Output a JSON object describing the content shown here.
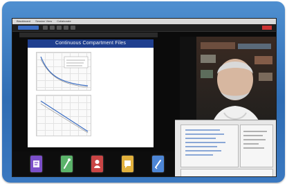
{
  "menubar": {
    "items": [
      "Blackboard",
      "Session View",
      "Collaborate"
    ]
  },
  "slide": {
    "title": "Continuous Compartment Files"
  },
  "colors": {
    "frame": "#3a78c0",
    "slide_title_bg": "#1f3f8f",
    "dock_purple": "#7b4fc9",
    "dock_green": "#5bb36a",
    "dock_red": "#c94545",
    "dock_yellow": "#e2b13d",
    "dock_blue": "#4d86d6"
  },
  "icons": [
    "menu-icon",
    "share-icon",
    "tools-icon",
    "participants-icon",
    "chat-icon",
    "notes-icon",
    "apps-icon",
    "record-icon"
  ]
}
